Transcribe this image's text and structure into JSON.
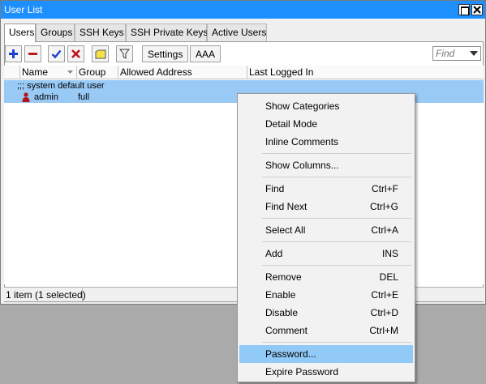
{
  "window": {
    "title": "User List"
  },
  "tabs": [
    "Users",
    "Groups",
    "SSH Keys",
    "SSH Private Keys",
    "Active Users"
  ],
  "toolbar": {
    "settings_label": "Settings",
    "aaa_label": "AAA",
    "find_placeholder": "Find"
  },
  "table": {
    "columns": [
      "Name",
      "Group",
      "Allowed Address",
      "Last Logged In"
    ],
    "comment": ";;; system default user",
    "row": {
      "name": "admin",
      "group": "full",
      "allowed_address": "",
      "last_logged_in": ""
    }
  },
  "status": {
    "selection": "1 item (1 selected)"
  },
  "context_menu": {
    "items": [
      {
        "label": "Show Categories",
        "shortcut": ""
      },
      {
        "label": "Detail Mode",
        "shortcut": ""
      },
      {
        "label": "Inline Comments",
        "shortcut": ""
      },
      {
        "label": "Show Columns...",
        "shortcut": ""
      },
      {
        "label": "Find",
        "shortcut": "Ctrl+F"
      },
      {
        "label": "Find Next",
        "shortcut": "Ctrl+G"
      },
      {
        "label": "Select All",
        "shortcut": "Ctrl+A"
      },
      {
        "label": "Add",
        "shortcut": "INS"
      },
      {
        "label": "Remove",
        "shortcut": "DEL"
      },
      {
        "label": "Enable",
        "shortcut": "Ctrl+E"
      },
      {
        "label": "Disable",
        "shortcut": "Ctrl+D"
      },
      {
        "label": "Comment",
        "shortcut": "Ctrl+M"
      },
      {
        "label": "Password...",
        "shortcut": ""
      },
      {
        "label": "Expire Password",
        "shortcut": ""
      }
    ],
    "highlighted": "Password..."
  },
  "colors": {
    "titlebar": "#1e8fff",
    "selection": "#99c9f5",
    "menu_highlight": "#91c9f7",
    "desktop": "#aaaaaa"
  }
}
